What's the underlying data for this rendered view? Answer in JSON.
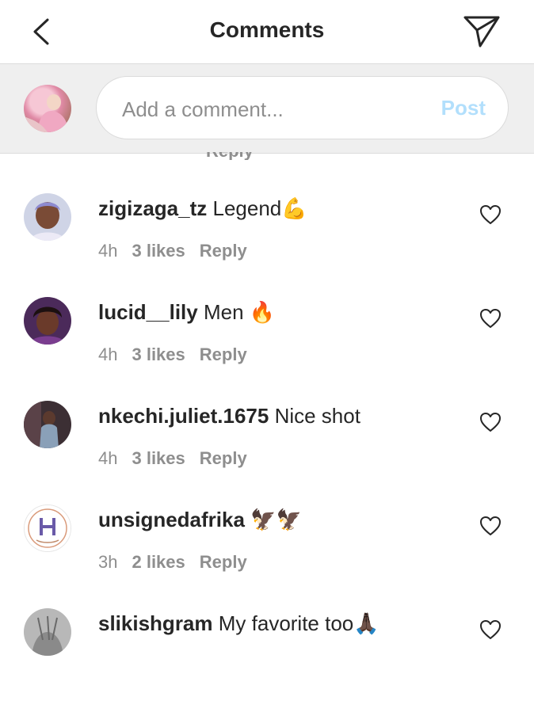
{
  "header": {
    "title": "Comments"
  },
  "compose": {
    "placeholder": "Add a comment...",
    "post_label": "Post"
  },
  "partial_reply_label": "Reply",
  "comments": [
    {
      "user": "zigizaga_tz",
      "text": "Legend💪",
      "time": "4h",
      "likes": "3 likes",
      "reply": "Reply"
    },
    {
      "user": "lucid__lily",
      "text": "Men 🔥",
      "time": "4h",
      "likes": "3 likes",
      "reply": "Reply"
    },
    {
      "user": "nkechi.juliet.1675",
      "text": "Nice shot",
      "time": "4h",
      "likes": "3 likes",
      "reply": "Reply"
    },
    {
      "user": "unsignedafrika",
      "text": "🦅🦅",
      "time": "3h",
      "likes": "2 likes",
      "reply": "Reply"
    },
    {
      "user": "slikishgram",
      "text": "My favorite too🙏🏿",
      "time": "",
      "likes": "",
      "reply": ""
    }
  ],
  "icons": {
    "back": "chevron-left-icon",
    "send": "paper-plane-icon",
    "like": "heart-outline-icon"
  },
  "colors": {
    "post_disabled": "#b2dffc",
    "muted": "#8e8e8e",
    "text": "#262626"
  }
}
